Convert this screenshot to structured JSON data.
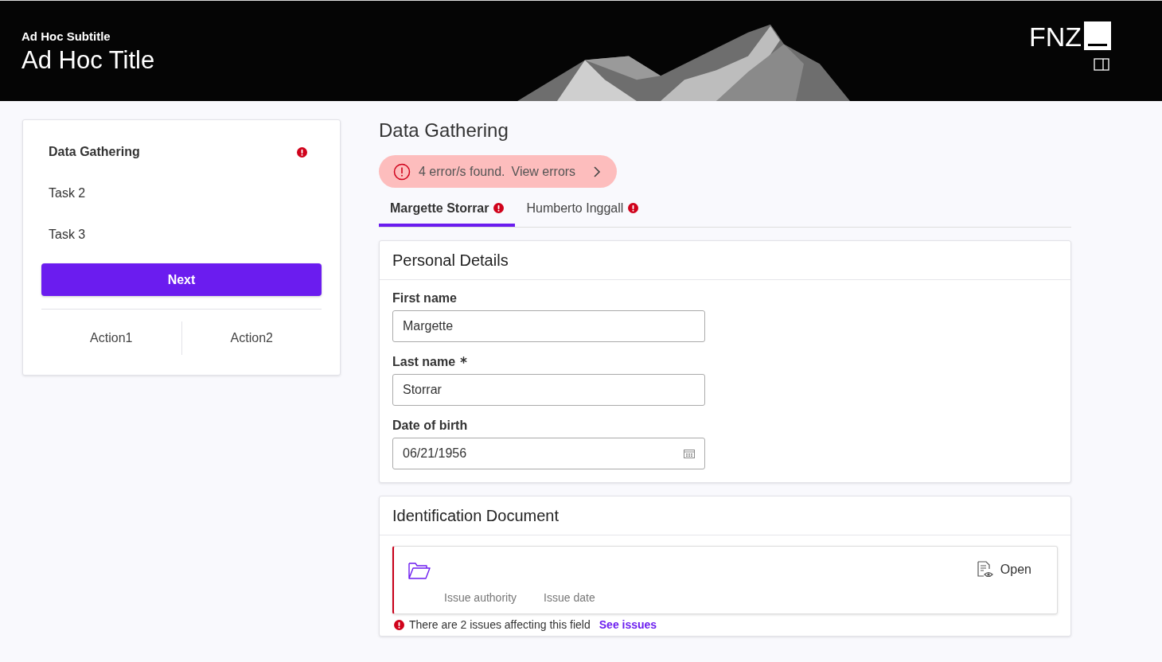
{
  "header": {
    "subtitle": "Ad Hoc Subtitle",
    "title": "Ad Hoc Title",
    "logo": "FNZ"
  },
  "sidebar": {
    "items": [
      {
        "label": "Data Gathering",
        "selected": true,
        "error": true
      },
      {
        "label": "Task 2",
        "selected": false,
        "error": false
      },
      {
        "label": "Task 3",
        "selected": false,
        "error": false
      }
    ],
    "next_button": "Next",
    "actions": [
      "Action1",
      "Action2"
    ]
  },
  "main": {
    "heading": "Data Gathering",
    "error_banner": {
      "text": "4 error/s found.",
      "link": "View errors"
    },
    "tabs": [
      {
        "label": "Margette Storrar",
        "selected": true,
        "error": true
      },
      {
        "label": "Humberto Inggall",
        "selected": false,
        "error": true
      }
    ],
    "personal_details": {
      "title": "Personal Details",
      "fields": [
        {
          "kind": "text",
          "label": "First name",
          "required": false,
          "value": "Margette"
        },
        {
          "kind": "text",
          "label": "Last name",
          "required": true,
          "value": "Storrar"
        },
        {
          "kind": "date",
          "label": "Date of birth",
          "required": false,
          "value": "06/21/1956"
        }
      ]
    },
    "identification": {
      "title": "Identification Document",
      "error": true,
      "open_button": "Open",
      "columns": [
        "Issue authority",
        "Issue date"
      ],
      "issue_message": "There are 2 issues affecting this field",
      "issue_link": "See issues"
    }
  }
}
